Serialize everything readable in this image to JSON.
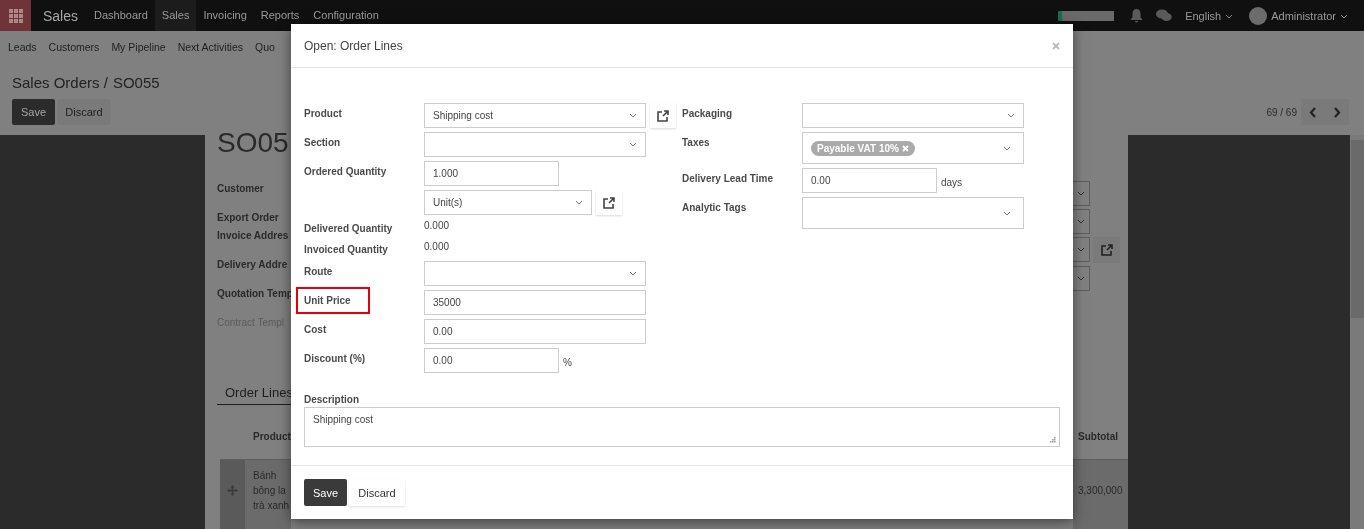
{
  "top_bar": {
    "app_name": "Sales",
    "menu": [
      {
        "label": "Dashboard",
        "selected": false
      },
      {
        "label": "Sales",
        "selected": true
      },
      {
        "label": "Invoicing",
        "selected": false
      },
      {
        "label": "Reports",
        "selected": false
      },
      {
        "label": "Configuration",
        "selected": false
      }
    ],
    "language": "English",
    "user": "Administrator"
  },
  "sub_menu": [
    "Leads",
    "Customers",
    "My Pipeline",
    "Next Activities",
    "Quo"
  ],
  "breadcrumb": {
    "parent": "Sales Orders /",
    "current": "SO055"
  },
  "buttons": [
    "Save",
    "Discard"
  ],
  "pager": "69 / 69",
  "record": {
    "title": "SO05",
    "fields": [
      {
        "label": "Customer",
        "muted": false
      },
      {
        "label": "Export Order",
        "muted": false
      },
      {
        "label": "Invoice Addres",
        "muted": false
      },
      {
        "label": "Delivery Addre",
        "muted": false
      },
      {
        "label": "Quotation Temp",
        "muted": false
      },
      {
        "label": "Contract Templ",
        "muted": true
      }
    ],
    "tab": "Order Lines",
    "column": "Product",
    "subtotal_column": "Subtotal",
    "row": {
      "product": [
        "Bánh",
        "bông la",
        "trà xanh"
      ],
      "subtotal": "3,300,000"
    }
  },
  "dialog": {
    "title": "Open: Order Lines",
    "left_fields": [
      {
        "kind": "select",
        "label": "Product",
        "value": "Shipping cost",
        "link": true,
        "short": false
      },
      {
        "kind": "select",
        "label": "Section",
        "short": false
      },
      {
        "kind": "input",
        "label": "Ordered Quantity",
        "value": "1.000",
        "short": true
      },
      {
        "kind": "select",
        "value": "Unit(s)",
        "link": true,
        "short": true
      },
      {
        "kind": "text",
        "label": "Delivered Quantity",
        "value": "0.000"
      },
      {
        "kind": "text",
        "label": "Invoiced Quantity",
        "value": "0.000"
      },
      {
        "kind": "select",
        "label": "Route",
        "short": false
      },
      {
        "kind": "input",
        "label": "Unit Price",
        "value": "35000",
        "short": false,
        "highlighted": true
      },
      {
        "kind": "input",
        "label": "Cost",
        "value": "0.00",
        "short": false
      },
      {
        "kind": "input",
        "label": "Discount (%)",
        "value": "0.00",
        "short": true,
        "suffix": "%"
      }
    ],
    "right_fields": [
      {
        "kind": "select",
        "label": "Packaging",
        "short": false
      },
      {
        "kind": "tags",
        "label": "Taxes",
        "tags": [
          "Payable VAT 10%"
        ]
      },
      {
        "kind": "input",
        "label": "Delivery Lead Time",
        "value": "0.00",
        "short": true,
        "suffix": "days"
      },
      {
        "kind": "tags",
        "label": "Analytic Tags"
      }
    ],
    "description": {
      "label": "Description",
      "value": "Shipping cost"
    },
    "buttons": [
      "Save",
      "Discard"
    ]
  }
}
